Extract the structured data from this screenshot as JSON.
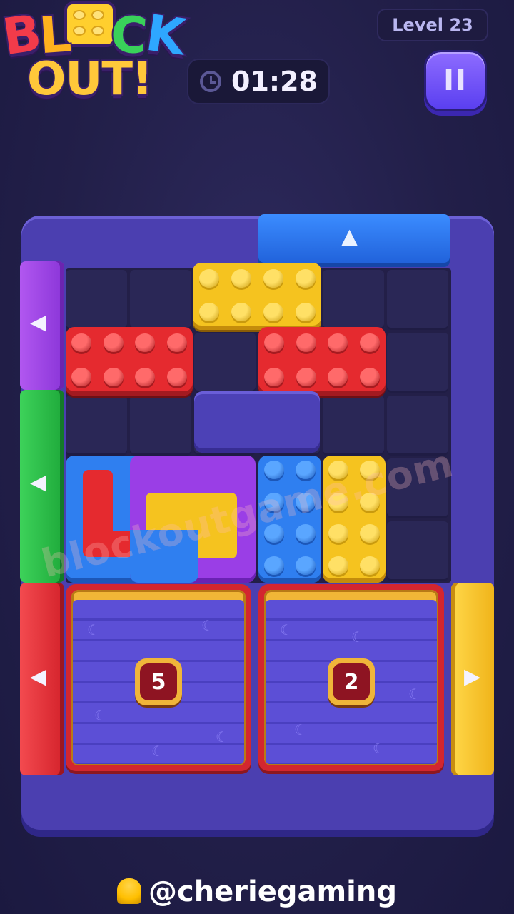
{
  "logo": {
    "line1": [
      "B",
      "L",
      "O",
      "C",
      "K"
    ],
    "line2": "OUT!"
  },
  "hud": {
    "level_label": "Level 23",
    "timer": "01:28",
    "pause_label": "II"
  },
  "gates": [
    {
      "name": "gate-top-blue",
      "color": "#1f6fe0",
      "arrow": "▲"
    },
    {
      "name": "gate-left-purple",
      "color": "#8e3de0",
      "arrow": "◀"
    },
    {
      "name": "gate-left-green",
      "color": "#1fb23c",
      "arrow": "◀"
    },
    {
      "name": "gate-left-red",
      "color": "#e02a32",
      "arrow": "◀"
    },
    {
      "name": "gate-right-yellow",
      "color": "#f3be1e",
      "arrow": "▶"
    }
  ],
  "pieces": [
    {
      "name": "yellow-brick-top",
      "color": "#f5c31f"
    },
    {
      "name": "red-brick-left",
      "color": "#e52a2f"
    },
    {
      "name": "red-brick-right",
      "color": "#e52a2f"
    },
    {
      "name": "purple-slab",
      "color": "#4c41b6"
    },
    {
      "name": "blue-l-brick",
      "color": "#2f7ff0"
    },
    {
      "name": "purple-hook-brick",
      "color": "#9a3ee6"
    },
    {
      "name": "blue-vertical-brick",
      "color": "#2f7ff0"
    },
    {
      "name": "yellow-vertical-brick",
      "color": "#f5c31f"
    }
  ],
  "boxes": [
    {
      "count": "5"
    },
    {
      "count": "2"
    }
  ],
  "watermark": "blockoutgame.com",
  "credit": "@cheriegaming"
}
